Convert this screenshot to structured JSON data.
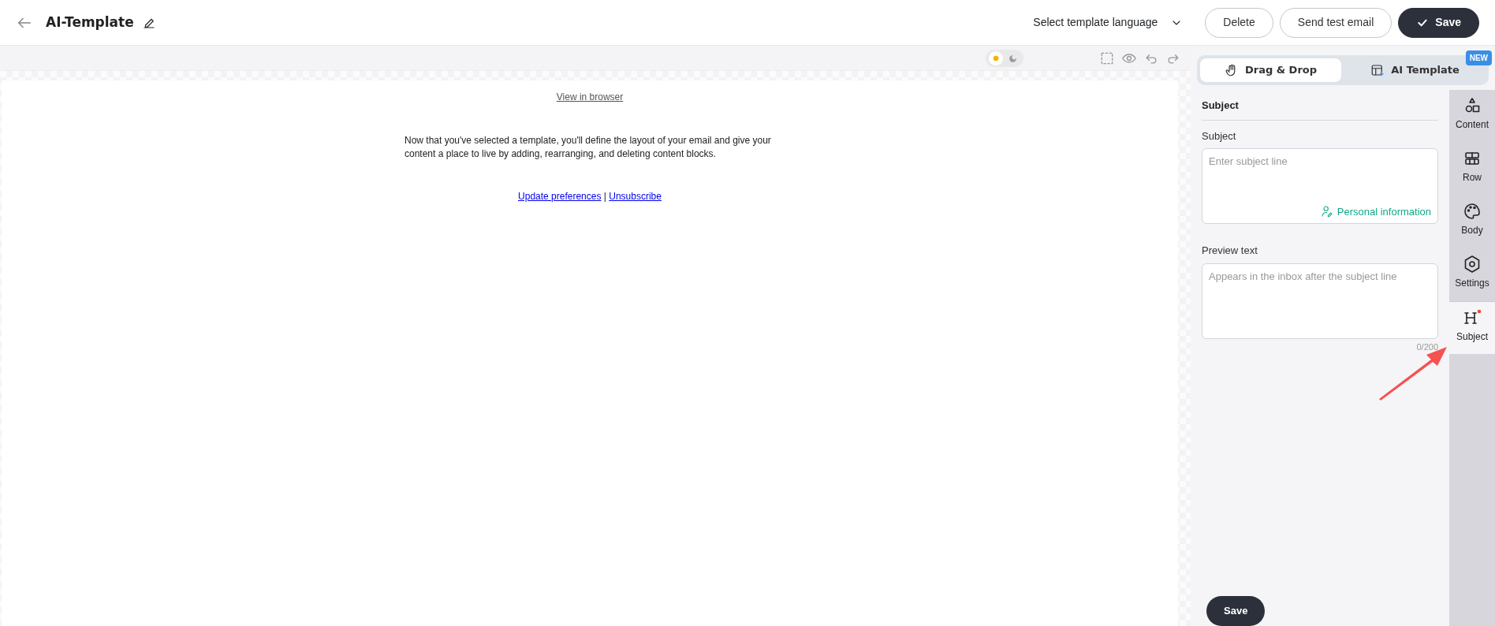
{
  "header": {
    "title": "AI-Template",
    "language_select": "Select template language",
    "buttons": [
      {
        "label": "Delete",
        "kind": "outline"
      },
      {
        "label": "Send test email",
        "kind": "outline"
      },
      {
        "label": "Save",
        "kind": "primary"
      }
    ]
  },
  "canvas_toolbar": {
    "theme_toggle": [
      {
        "kind": "sun",
        "selected": true
      },
      {
        "kind": "moon",
        "selected": false
      }
    ],
    "tools": [
      {
        "kind": "select"
      },
      {
        "kind": "preview"
      },
      {
        "kind": "undo"
      },
      {
        "kind": "redo"
      }
    ]
  },
  "email": {
    "view_link": "View in browser",
    "body": "Now that you've selected a template, you'll define the layout of your email and give your content a place to live by adding, rearranging, and deleting content blocks.",
    "footer_links": [
      "Update preferences",
      "Unsubscribe"
    ],
    "separator": "|"
  },
  "mode_tabs": [
    {
      "label": "Drag & Drop",
      "kind": "hand",
      "selected": true
    },
    {
      "label": "AI Template",
      "kind": "template",
      "selected": false,
      "badge": "NEW"
    }
  ],
  "panel": {
    "heading": "Subject",
    "subject_label": "Subject",
    "subject_placeholder": "Enter subject line",
    "personal_info": "Personal information",
    "preview_label": "Preview text",
    "preview_placeholder": "Appears in the inbox after the subject line",
    "counter": "0/200",
    "save": "Save"
  },
  "rail": [
    {
      "label": "Content",
      "kind": "shapes",
      "selected": false
    },
    {
      "label": "Row",
      "kind": "rows",
      "selected": false
    },
    {
      "label": "Body",
      "kind": "palette",
      "selected": false
    },
    {
      "label": "Settings",
      "kind": "hexagon",
      "selected": false
    },
    {
      "label": "Subject",
      "kind": "heading",
      "selected": true
    }
  ]
}
